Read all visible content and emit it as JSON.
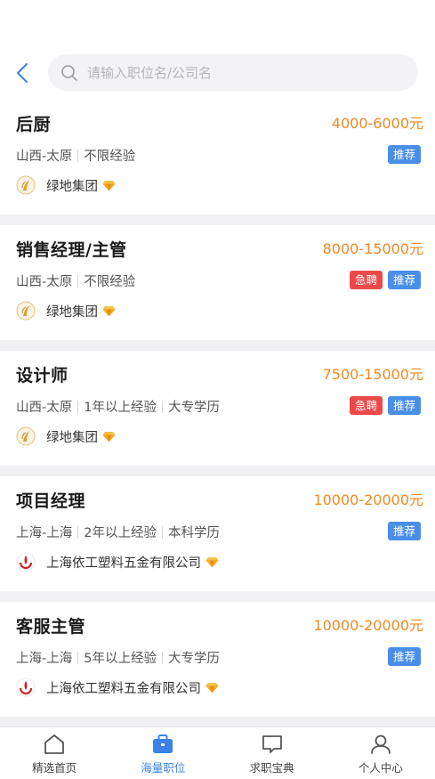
{
  "search": {
    "placeholder": "请输入职位名/公司名"
  },
  "jobs": [
    {
      "title": "后厨",
      "salary": "4000-6000元",
      "meta": [
        "山西-太原",
        "不限经验"
      ],
      "tags": [
        "推荐"
      ],
      "company": "绿地集团"
    },
    {
      "title": "销售经理/主管",
      "salary": "8000-15000元",
      "meta": [
        "山西-太原",
        "不限经验"
      ],
      "tags": [
        "急聘",
        "推荐"
      ],
      "company": "绿地集团"
    },
    {
      "title": "设计师",
      "salary": "7500-15000元",
      "meta": [
        "山西-太原",
        "1年以上经验",
        "大专学历"
      ],
      "tags": [
        "急聘",
        "推荐"
      ],
      "company": "绿地集团"
    },
    {
      "title": "项目经理",
      "salary": "10000-20000元",
      "meta": [
        "上海-上海",
        "2年以上经验",
        "本科学历"
      ],
      "tags": [
        "推荐"
      ],
      "company": "上海依工塑料五金有限公司"
    },
    {
      "title": "客服主管",
      "salary": "10000-20000元",
      "meta": [
        "上海-上海",
        "5年以上经验",
        "大专学历"
      ],
      "tags": [
        "推荐"
      ],
      "company": "上海依工塑料五金有限公司"
    }
  ],
  "tabs": [
    {
      "label": "精选首页",
      "icon": "home-icon"
    },
    {
      "label": "海量职位",
      "icon": "briefcase-icon"
    },
    {
      "label": "求职宝典",
      "icon": "chat-icon"
    },
    {
      "label": "个人中心",
      "icon": "user-icon"
    }
  ],
  "colors": {
    "accent": "#3b82e6",
    "salary": "#f08a24",
    "recommend": "#4a8ee8",
    "urgent": "#ec4a4a"
  }
}
